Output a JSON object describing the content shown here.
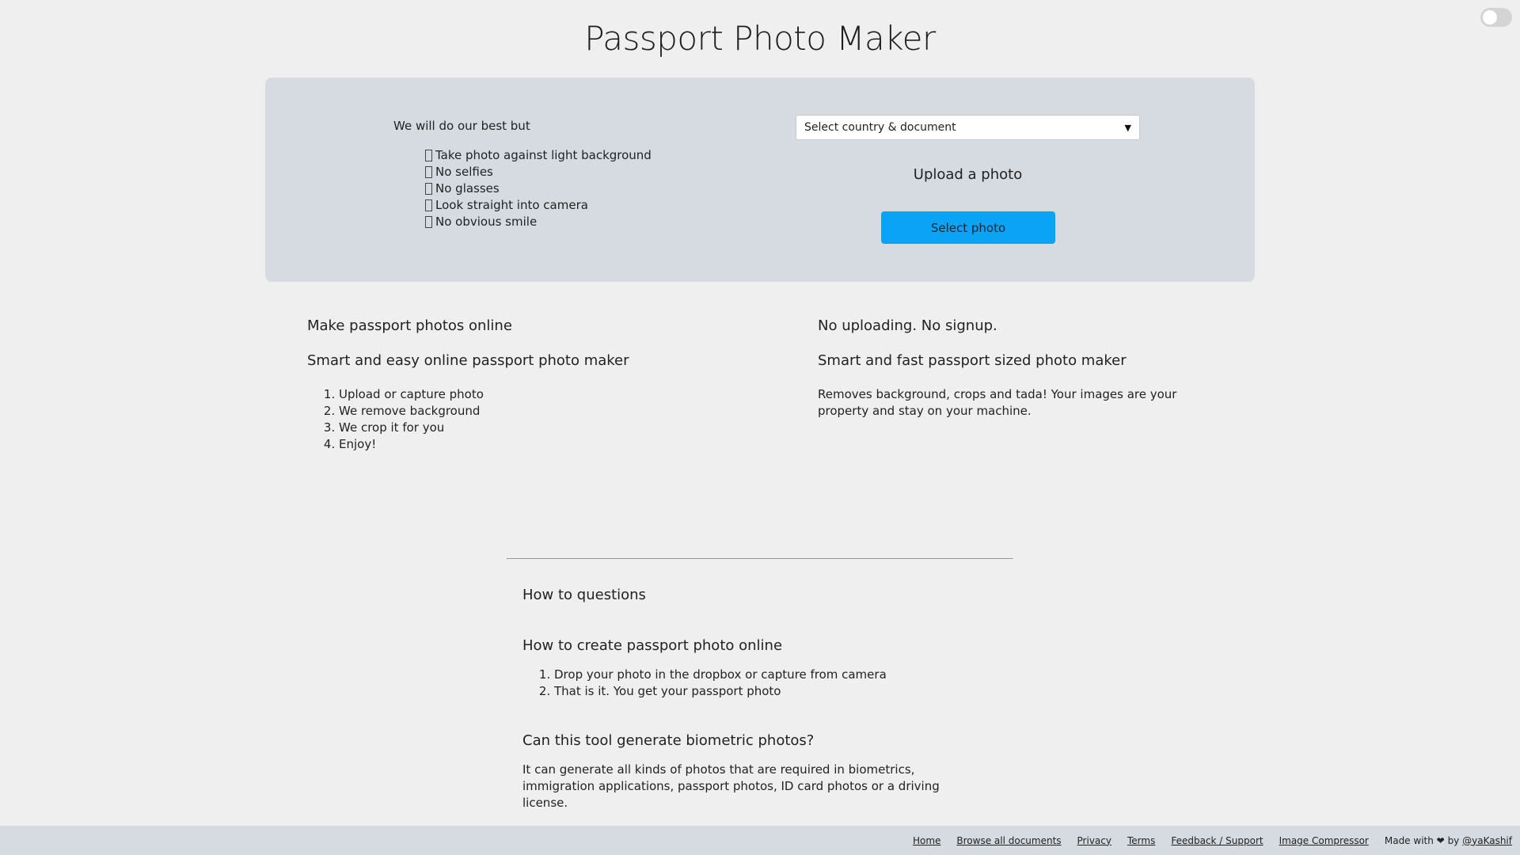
{
  "header": {
    "title": "Passport Photo Maker"
  },
  "upload_card": {
    "tips_intro": "We will do our best but",
    "tips": [
      "Take photo against light background",
      "No selfies",
      "No glasses",
      "Look straight into camera",
      "No obvious smile"
    ],
    "document_select": {
      "selected": "Select country & document"
    },
    "upload_label": "Upload a photo",
    "select_photo_label": "Select photo",
    "accent_color": "#0aa3f5"
  },
  "info": {
    "left": {
      "heading1": "Make passport photos online",
      "heading2": "Smart and easy online passport photo maker",
      "steps": [
        "Upload or capture photo",
        "We remove background",
        "We crop it for you",
        "Enjoy!"
      ]
    },
    "right": {
      "heading1": "No uploading. No signup.",
      "heading2": "Smart and fast passport sized photo maker",
      "body": "Removes background, crops and tada! Your images are your property and stay on your machine."
    }
  },
  "faq": {
    "heading": "How to questions",
    "q1": "How to create passport photo online",
    "q1_steps": [
      "Drop your photo in the dropbox or capture from camera",
      "That is it. You get your passport photo"
    ],
    "q2": "Can this tool generate biometric photos?",
    "q2_answer": "It can generate all kinds of photos that are required in biometrics, immigration applications, passport photos, ID card photos or a driving license."
  },
  "footer": {
    "links": [
      "Home",
      "Browse all documents",
      "Privacy",
      "Terms",
      "Feedback / Support",
      "Image Compressor"
    ],
    "made_with": "Made with",
    "heart": "❤",
    "by": "by",
    "author": "@yaKashif"
  }
}
